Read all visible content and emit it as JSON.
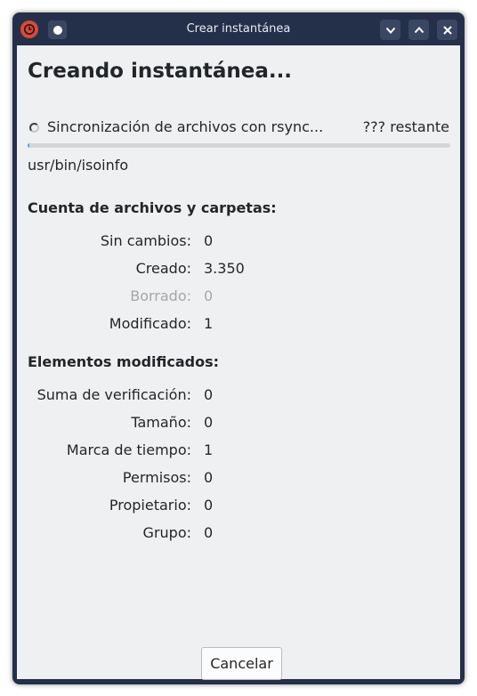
{
  "window": {
    "title": "Crear instantánea",
    "icons": {
      "app": "backintime-icon",
      "pin": "keep-on-top-icon",
      "minimize": "chevron-down-icon",
      "maximize": "chevron-up-icon",
      "close": "close-icon"
    },
    "colors": {
      "titlebar": "#24304a",
      "content": "#eff0f1",
      "accent": "#3daee9"
    }
  },
  "main": {
    "heading": "Creando instantánea...",
    "status": "Sincronización de archivos con rsync...",
    "remaining": "??? restante",
    "progress_fraction": 0.0,
    "current_file": "usr/bin/isoinfo"
  },
  "counts": {
    "title": "Cuenta de archivos y carpetas:",
    "rows": [
      {
        "label": "Sin cambios:",
        "value": "0"
      },
      {
        "label": "Creado:",
        "value": "3.350"
      },
      {
        "label": "Borrado:",
        "value": "0",
        "disabled": true
      },
      {
        "label": "Modificado:",
        "value": "1"
      }
    ]
  },
  "changed": {
    "title": "Elementos modificados:",
    "rows": [
      {
        "label": "Suma de verificación:",
        "value": "0"
      },
      {
        "label": "Tamaño:",
        "value": "0"
      },
      {
        "label": "Marca de tiempo:",
        "value": "1"
      },
      {
        "label": "Permisos:",
        "value": "0"
      },
      {
        "label": "Propietario:",
        "value": "0"
      },
      {
        "label": "Grupo:",
        "value": "0"
      }
    ]
  },
  "footer": {
    "cancel_label": "Cancelar"
  }
}
